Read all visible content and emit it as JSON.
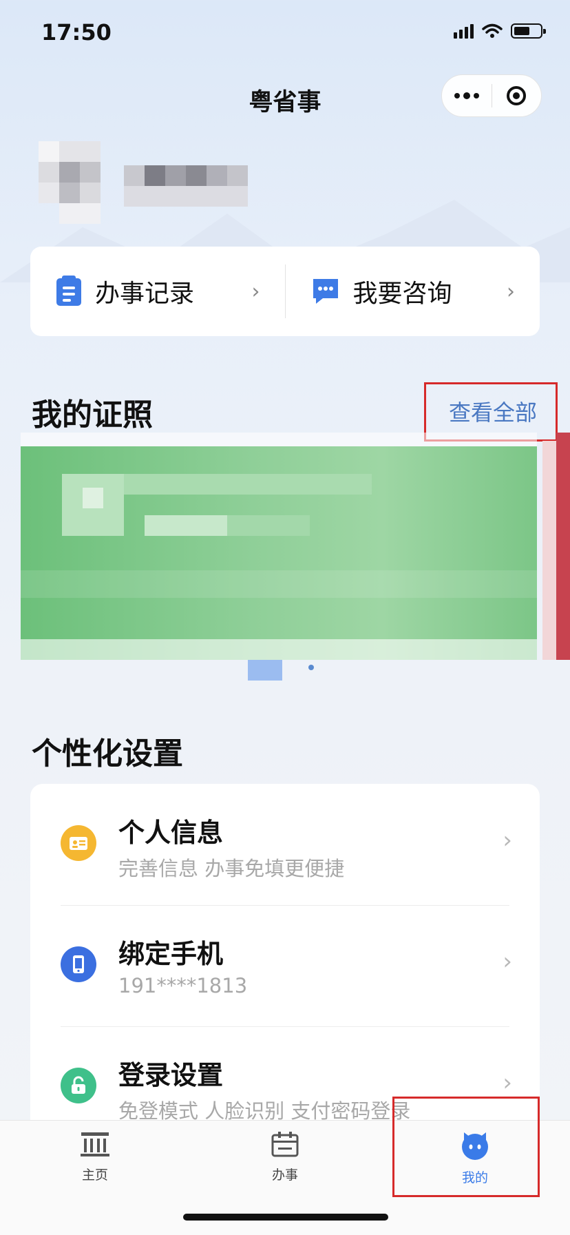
{
  "status_bar": {
    "time": "17:50"
  },
  "nav": {
    "title": "粤省事"
  },
  "quick_actions": [
    {
      "label": "办事记录"
    },
    {
      "label": "我要咨询"
    }
  ],
  "certificates": {
    "title": "我的证照",
    "view_all": "查看全部"
  },
  "personalization": {
    "title": "个性化设置",
    "items": [
      {
        "title": "个人信息",
        "subtitle": "完善信息 办事免填更便捷",
        "icon_color": "#f5b731"
      },
      {
        "title": "绑定手机",
        "subtitle": "191****1813",
        "icon_color": "#3b6fe0"
      },
      {
        "title": "登录设置",
        "subtitle": "免登模式 人脸识别 支付密码登录",
        "icon_color": "#3fc08a"
      }
    ]
  },
  "tabbar": {
    "items": [
      {
        "label": "主页"
      },
      {
        "label": "办事"
      },
      {
        "label": "我的"
      }
    ],
    "active": "我的"
  },
  "colors": {
    "accent": "#3a7be8",
    "highlight_box": "#d62a2a"
  }
}
